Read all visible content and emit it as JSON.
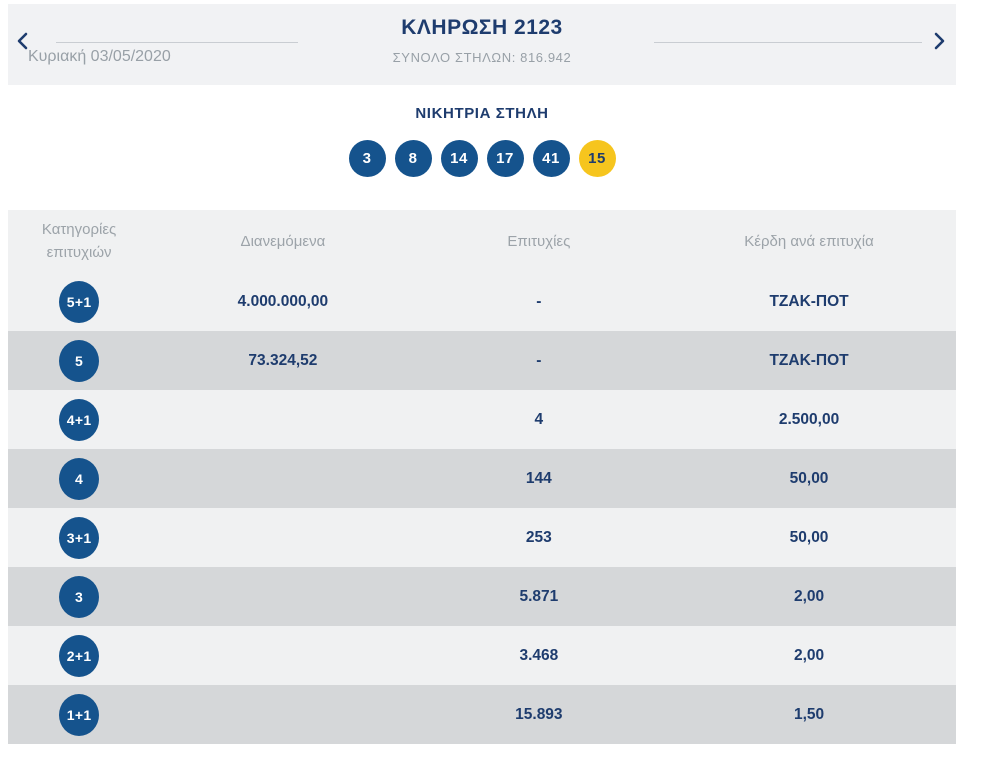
{
  "header": {
    "title": "ΚΛΗΡΩΣΗ 2123",
    "subtitle": "ΣΥΝΟΛΟ ΣΤΗΛΩΝ: 816.942",
    "date": "Κυριακή 03/05/2020",
    "icons": {
      "prev": "chevron-left",
      "next": "chevron-right"
    }
  },
  "winning": {
    "label": "ΝΙΚΗΤΡΙΑ ΣΤΗΛΗ",
    "numbers": [
      {
        "value": "3",
        "type": "main"
      },
      {
        "value": "8",
        "type": "main"
      },
      {
        "value": "14",
        "type": "main"
      },
      {
        "value": "17",
        "type": "main"
      },
      {
        "value": "41",
        "type": "main"
      },
      {
        "value": "15",
        "type": "bonus"
      }
    ]
  },
  "table": {
    "columns": [
      "Κατηγορίες επιτυχιών",
      "Διανεμόμενα",
      "Επιτυχίες",
      "Κέρδη ανά επιτυχία"
    ],
    "rows": [
      {
        "category": "5+1",
        "distributed": "4.000.000,00",
        "winners": "-",
        "prize": "ΤΖΑΚ-ΠΟΤ"
      },
      {
        "category": "5",
        "distributed": "73.324,52",
        "winners": "-",
        "prize": "ΤΖΑΚ-ΠΟΤ"
      },
      {
        "category": "4+1",
        "distributed": "",
        "winners": "4",
        "prize": "2.500,00"
      },
      {
        "category": "4",
        "distributed": "",
        "winners": "144",
        "prize": "50,00"
      },
      {
        "category": "3+1",
        "distributed": "",
        "winners": "253",
        "prize": "50,00"
      },
      {
        "category": "3",
        "distributed": "",
        "winners": "5.871",
        "prize": "2,00"
      },
      {
        "category": "2+1",
        "distributed": "",
        "winners": "3.468",
        "prize": "2,00"
      },
      {
        "category": "1+1",
        "distributed": "",
        "winners": "15.893",
        "prize": "1,50"
      }
    ]
  },
  "colors": {
    "navy_text": "#1e3c6e",
    "ball_blue": "#15538d",
    "bonus_yellow": "#f6c51e",
    "row_light": "#f0f1f2",
    "row_dark": "#d5d7d9",
    "header_strip_bg": "#f1f2f4",
    "muted_gray_text": "#98a0a7",
    "divider_line": "#c9cdd2"
  }
}
